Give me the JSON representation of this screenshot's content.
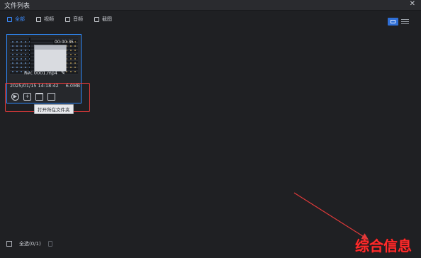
{
  "window": {
    "title": "文件列表",
    "close_glyph": "✕"
  },
  "tabs": [
    {
      "label": "全部",
      "active": true
    },
    {
      "label": "视频",
      "active": false
    },
    {
      "label": "音频",
      "active": false
    },
    {
      "label": "截图",
      "active": false
    }
  ],
  "view": {
    "grid_active": true
  },
  "file": {
    "name": "Rec 0001.mp4",
    "duration": "00:00:35",
    "datetime": "2025/01/15 14:18:42",
    "size": "6.0MB"
  },
  "actions": {
    "play": "▶",
    "add": "+",
    "folder": "",
    "delete": ""
  },
  "tooltip": {
    "text": "打开所在文件夹"
  },
  "footer": {
    "select_all_label": "全选(0/1)"
  },
  "overlay": {
    "watermark_text": "综合信息",
    "arrow_color": "#e23a3a",
    "highlight_color": "#e23a3a"
  },
  "colors": {
    "accent": "#2f8cff",
    "background": "#1f2023"
  }
}
